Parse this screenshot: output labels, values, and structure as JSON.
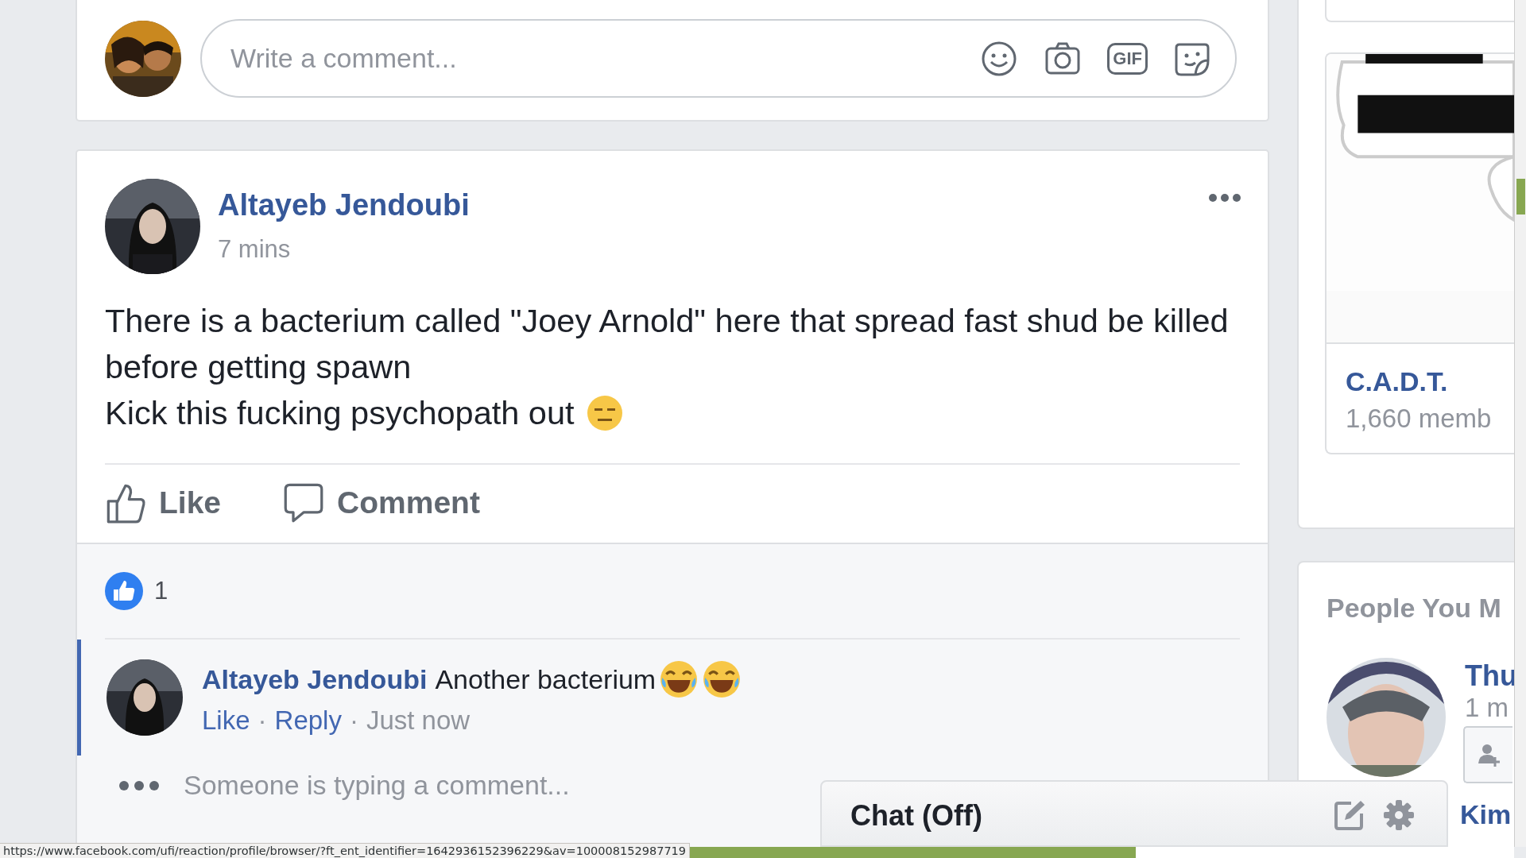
{
  "composer": {
    "placeholder": "Write a comment...",
    "gif_label": "GIF"
  },
  "post": {
    "author": "Altayeb Jendoubi",
    "time": "7 mins",
    "paragraphs": [
      "There is a bacterium called \"Joey Arnold\" here that spread fast shud be killed before getting spawn",
      "Kick this fucking psychopath out"
    ],
    "actions": [
      {
        "kind": "like",
        "label": "Like"
      },
      {
        "kind": "comment",
        "label": "Comment"
      }
    ],
    "reaction_count": "1"
  },
  "comments": [
    {
      "author": "Altayeb Jendoubi",
      "text": "Another bacterium",
      "actions": [
        "Like",
        "Reply"
      ],
      "separator": "·",
      "time": "Just now"
    }
  ],
  "typing": "Someone is typing a comment...",
  "sidebar": {
    "group": {
      "name": "C.A.D.T.",
      "members": "1,660 memb"
    },
    "people": {
      "title": "People You M",
      "items": [
        {
          "name": "Thu",
          "info": "1 m"
        },
        {
          "name": "Kim"
        }
      ]
    }
  },
  "chat": {
    "title": "Chat (Off)"
  },
  "status_bar": {
    "url": "https://www.facebook.com/ufi/reaction/profile/browser/?ft_ent_identifier=1642936152396229&av=100008152987719"
  },
  "loading_bar": {
    "level": 0.75
  }
}
